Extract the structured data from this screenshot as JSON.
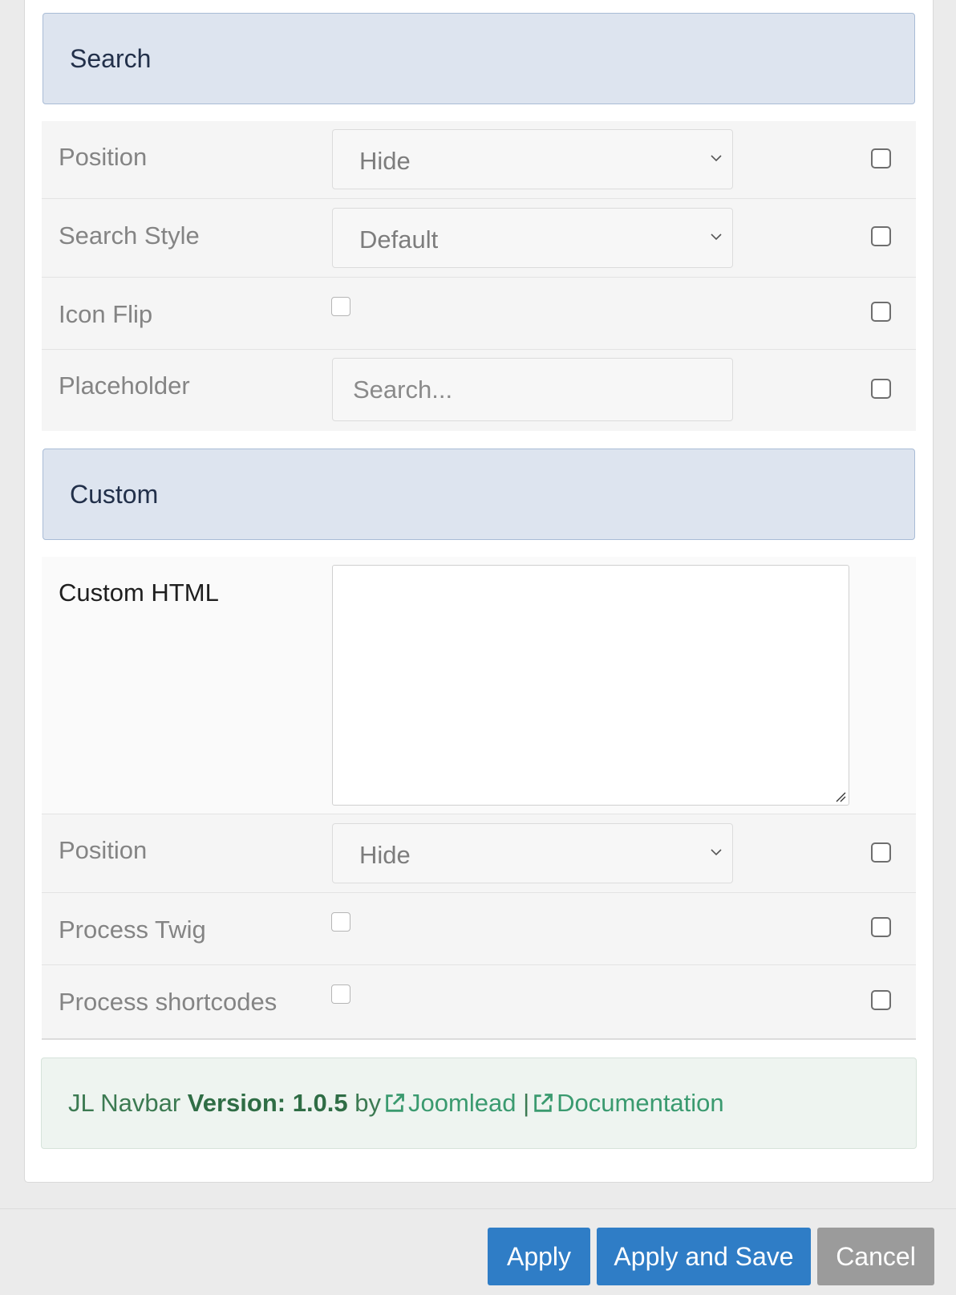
{
  "search_section": {
    "title": "Search",
    "position": {
      "label": "Position",
      "value": "Hide"
    },
    "search_style": {
      "label": "Search Style",
      "value": "Default"
    },
    "icon_flip": {
      "label": "Icon Flip"
    },
    "placeholder": {
      "label": "Placeholder",
      "placeholder": "Search..."
    }
  },
  "custom_section": {
    "title": "Custom",
    "custom_html": {
      "label": "Custom HTML"
    },
    "position": {
      "label": "Position",
      "value": "Hide"
    },
    "process_twig": {
      "label": "Process Twig"
    },
    "process_shortcodes": {
      "label": "Process shortcodes"
    }
  },
  "footer": {
    "product": "JL Navbar",
    "version_label": "Version: 1.0.5",
    "by": "by",
    "author_link": "Joomlead",
    "separator": "|",
    "docs_link": "Documentation"
  },
  "actions": {
    "apply": "Apply",
    "apply_save": "Apply and Save",
    "cancel": "Cancel"
  }
}
